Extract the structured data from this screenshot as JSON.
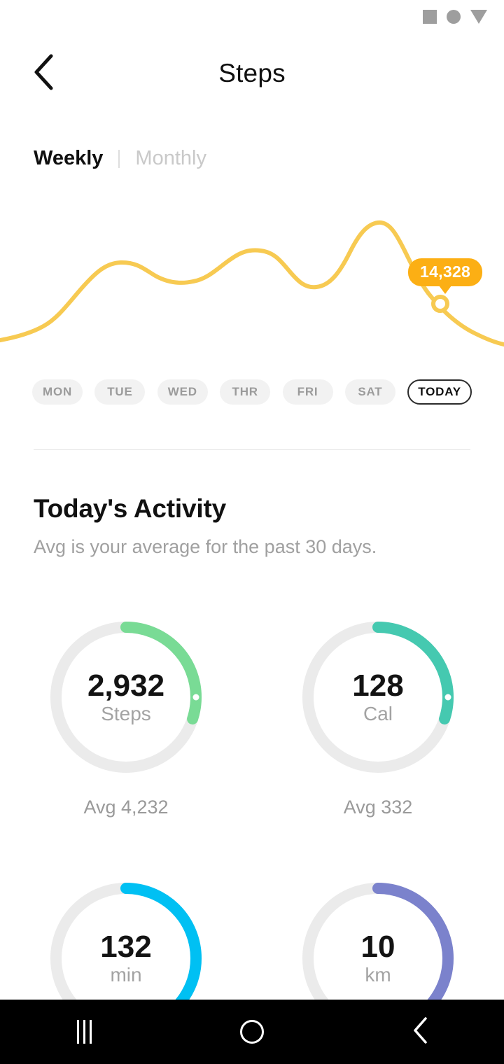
{
  "status_bar": {
    "icons": [
      "square-icon",
      "circle-icon",
      "triangle-down-icon"
    ],
    "color": "#9e9e9e"
  },
  "app_bar": {
    "back_icon": "chevron-left-icon",
    "title": "Steps"
  },
  "period_tabs": {
    "weekly_label": "Weekly",
    "monthly_label": "Monthly",
    "active": "Weekly"
  },
  "chart_data": {
    "type": "line",
    "title": "Steps",
    "xlabel": "",
    "ylabel": "Steps",
    "categories": [
      "MON",
      "TUE",
      "WED",
      "THR",
      "FRI",
      "SAT",
      "TODAY"
    ],
    "series": [
      {
        "name": "Steps",
        "values": [
          4100,
          9800,
          8600,
          10600,
          8400,
          14800,
          14328
        ]
      }
    ],
    "line_color": "#F7CA52",
    "grid": false,
    "legend": "none",
    "highlight": {
      "label": "14,328",
      "category": "TODAY",
      "marker": "circle-marker",
      "badge_color": "#FCAF14",
      "badge_text_color": "#FFFFFF"
    }
  },
  "day_pills": [
    {
      "label": "MON",
      "selected": false
    },
    {
      "label": "TUE",
      "selected": false
    },
    {
      "label": "WED",
      "selected": false
    },
    {
      "label": "THR",
      "selected": false
    },
    {
      "label": "FRI",
      "selected": false
    },
    {
      "label": "SAT",
      "selected": false
    },
    {
      "label": "TODAY",
      "selected": true
    }
  ],
  "activity": {
    "heading": "Today's Activity",
    "subheading": "Avg is your average for the past 30 days.",
    "metrics": [
      {
        "value": "2,932",
        "unit": "Steps",
        "avg": "Avg 4,232",
        "color": "#79DB95",
        "progress_pct": 30
      },
      {
        "value": "128",
        "unit": "Cal",
        "avg": "Avg 332",
        "color": "#45C9B0",
        "progress_pct": 30
      },
      {
        "value": "132",
        "unit": "min",
        "avg": "",
        "color": "#00C0F3",
        "progress_pct": 44
      },
      {
        "value": "10",
        "unit": "km",
        "avg": "",
        "color": "#7B82CC",
        "progress_pct": 44
      }
    ]
  },
  "nav_bar": {
    "recents_label": "recents-icon",
    "home_label": "home-icon",
    "back_label": "back-icon"
  }
}
